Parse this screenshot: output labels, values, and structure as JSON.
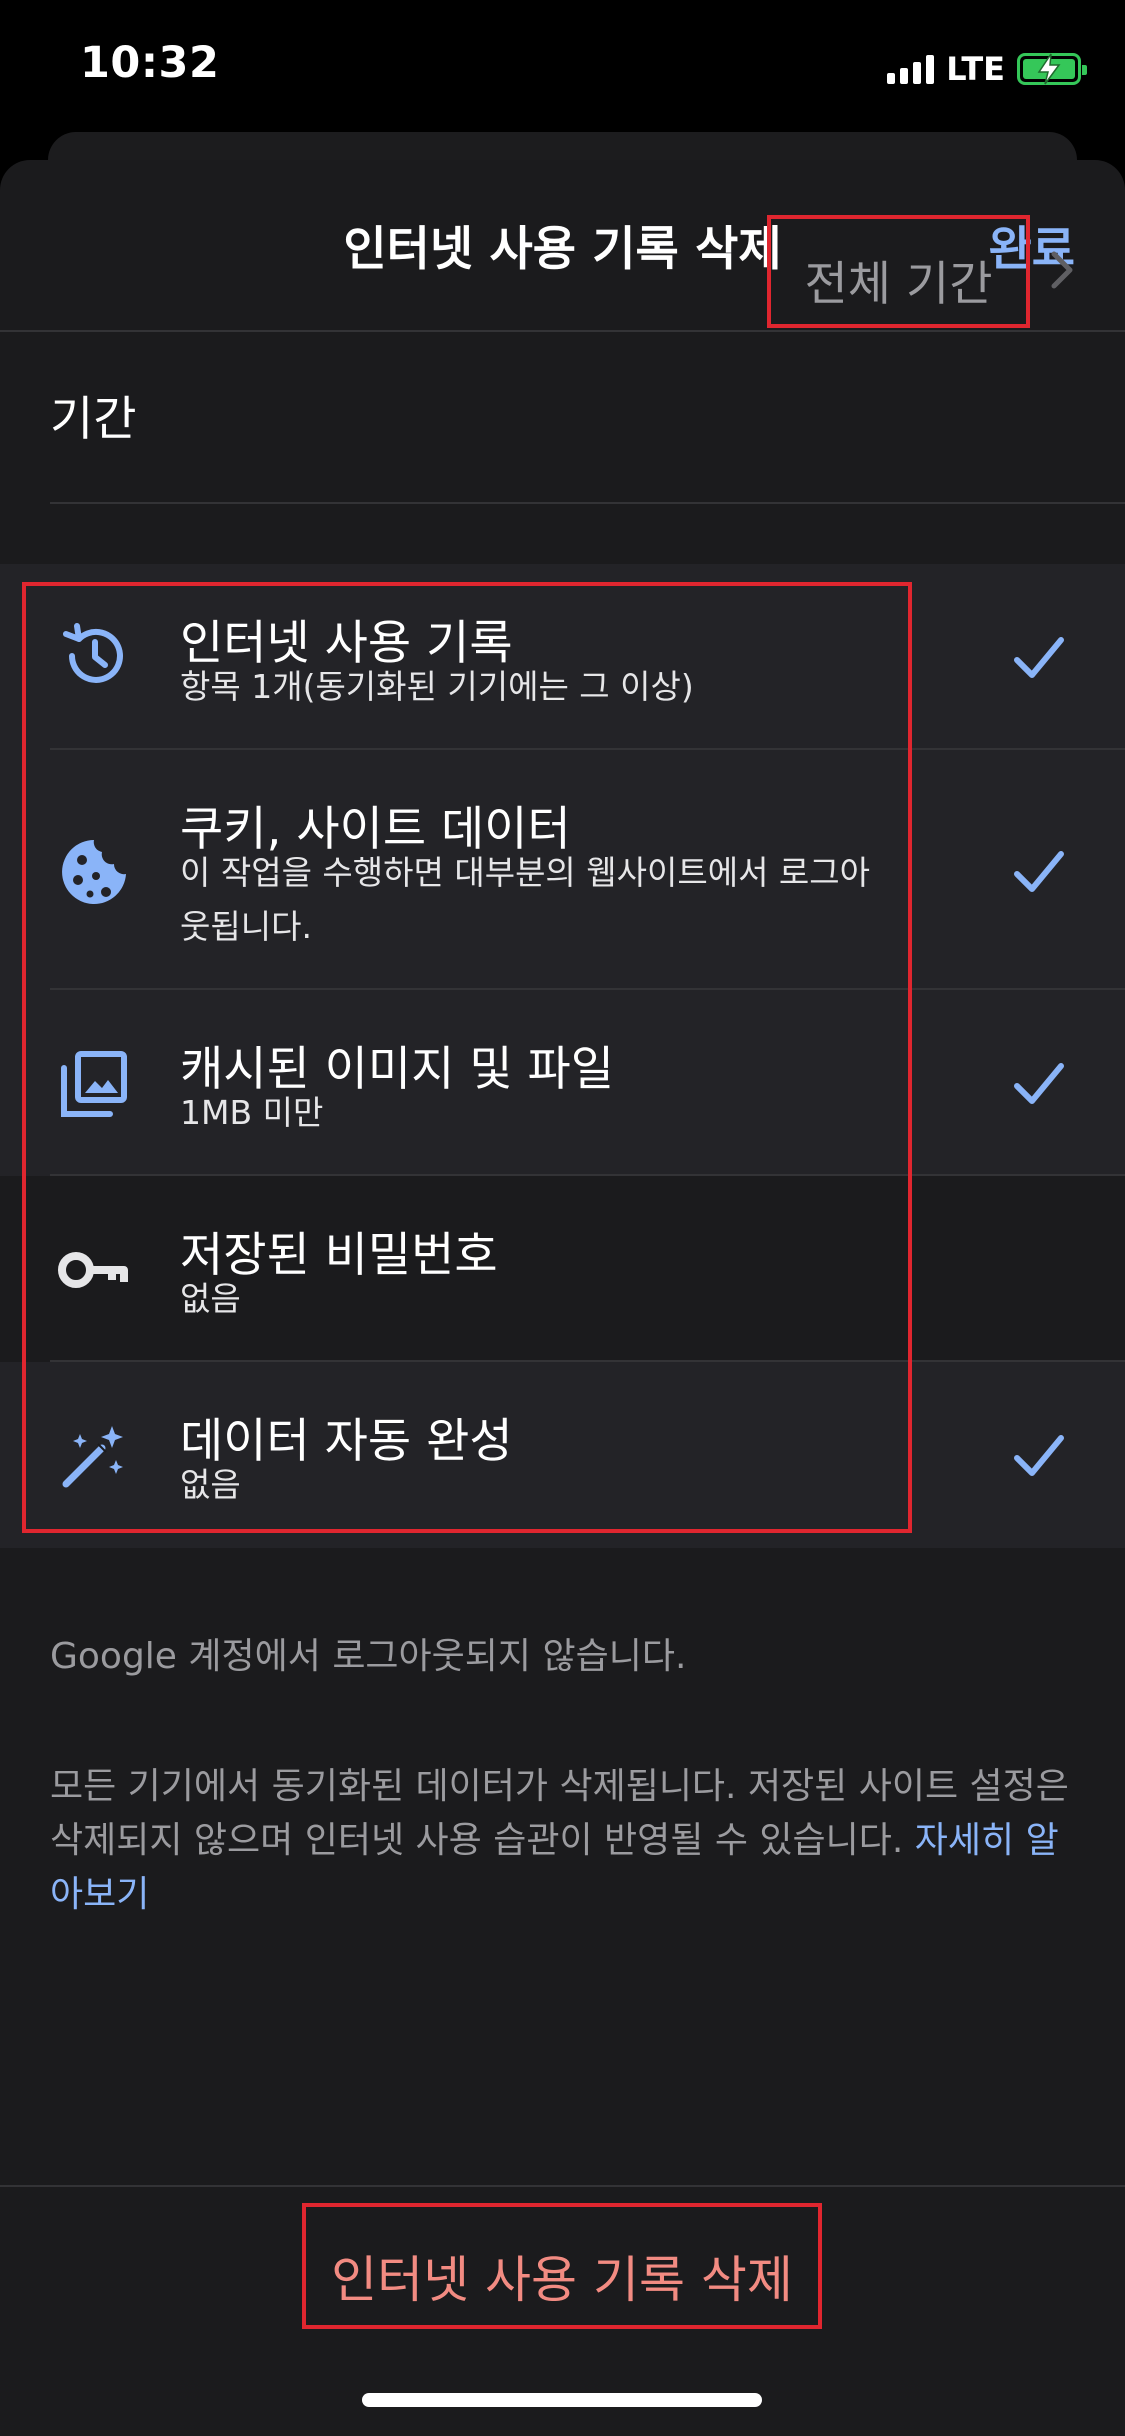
{
  "status_bar": {
    "time": "10:32",
    "network": "LTE"
  },
  "nav": {
    "title": "인터넷 사용 기록 삭제",
    "done_label": "완료"
  },
  "period": {
    "label": "기간",
    "value": "전체 기간"
  },
  "options": [
    {
      "title": "인터넷 사용 기록",
      "subtitle": "항목 1개(동기화된 기기에는 그 이상)",
      "checked": true,
      "icon": "history-icon"
    },
    {
      "title": "쿠키, 사이트 데이터",
      "subtitle": "이 작업을 수행하면 대부분의 웹사이트에서 로그아웃됩니다.",
      "checked": true,
      "icon": "cookie-icon"
    },
    {
      "title": "캐시된 이미지 및 파일",
      "subtitle": "1MB 미만",
      "checked": true,
      "icon": "image-icon"
    },
    {
      "title": "저장된 비밀번호",
      "subtitle": "없음",
      "checked": false,
      "icon": "key-icon"
    },
    {
      "title": "데이터 자동 완성",
      "subtitle": "없음",
      "checked": true,
      "icon": "magic-wand-icon"
    }
  ],
  "footnotes": {
    "account_note": "Google 계정에서 로그아웃되지 않습니다.",
    "sync_note": "모든 기기에서 동기화된 데이터가 삭제됩니다. 저장된 사이트 설정은 삭제되지 않으며 인터넷 사용 습관이 반영될 수 있습니다.",
    "learn_more": "자세히 알아보기"
  },
  "actions": {
    "delete_label": "인터넷 사용 기록 삭제"
  },
  "colors": {
    "accent": "#8ab4f8",
    "destructive": "#f28b82",
    "highlight": "#e0262f",
    "battery": "#35c759"
  }
}
